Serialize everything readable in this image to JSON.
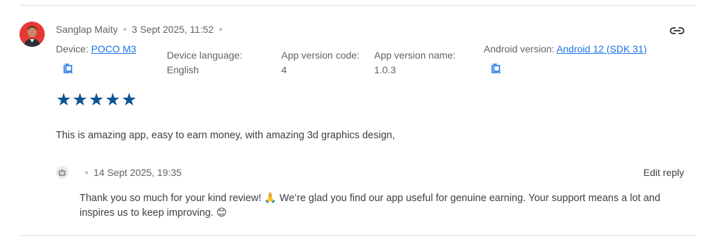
{
  "review": {
    "author": "Sanglap Maity",
    "date": "3 Sept 2025, 11:52",
    "device_label": "Device: ",
    "device_value": "POCO M3",
    "device_language_label": "Device language:",
    "device_language_value": "English",
    "app_version_code_label": "App version code:",
    "app_version_code_value": "4",
    "app_version_name_label": "App version name:",
    "app_version_name_value": "1.0.3",
    "android_version_label": "Android version: ",
    "android_version_value": "Android 12 (SDK 31)",
    "rating": 5,
    "stars": "★★★★★",
    "text": "This is amazing app, easy to earn money, with amazing 3d graphics design,"
  },
  "reply": {
    "date": "14 Sept 2025, 19:35",
    "edit_label": "Edit reply",
    "text": "Thank you so much for your kind review! 🙏 We’re glad you find our app useful for genuine earning. Your support means a lot and inspires us to keep improving. 😊"
  },
  "icons": {
    "link": "link-icon",
    "copy": "copy-to-clipboard-icon",
    "reply_badge": "developer-badge-icon"
  },
  "colors": {
    "star": "#0b5394",
    "link": "#1a73e8",
    "divider": "#dadce0"
  }
}
